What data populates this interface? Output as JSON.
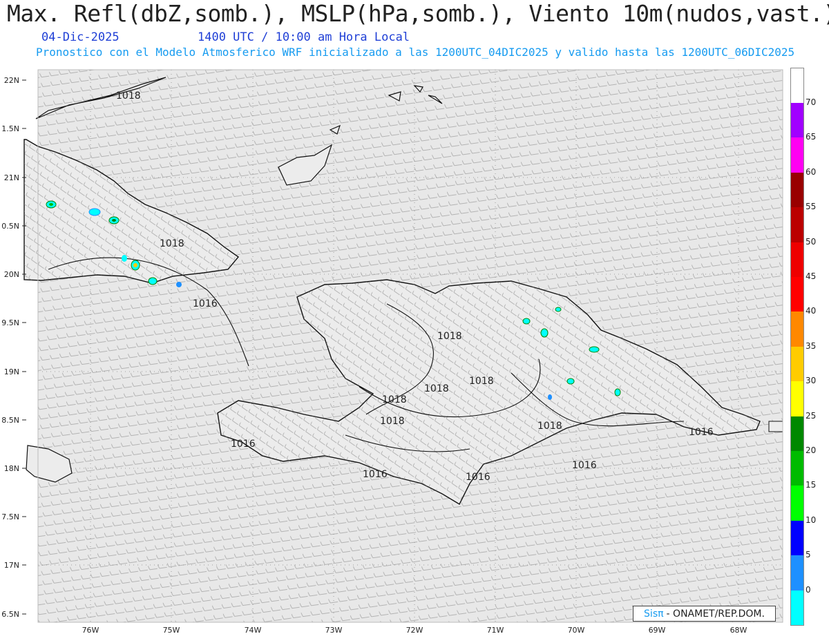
{
  "header": {
    "title": "Max. Refl(dbZ,somb.), MSLP(hPa,somb.), Viento 10m(nudos,vast.)",
    "date": "04-Dic-2025",
    "time": "1400 UTC / 10:00 am Hora Local",
    "model_info": "Pronostico con el Modelo Atmosferico WRF inicializado a las 1200UTC_04DIC2025 y valido hasta las  1200UTC_06DIC2025"
  },
  "axes": {
    "lat_labels": [
      "22N",
      "1.5N",
      "21N",
      "0.5N",
      "20N",
      "9.5N",
      "19N",
      "8.5N",
      "18N",
      "7.5N",
      "17N",
      "6.5N"
    ],
    "lon_labels": [
      "76W",
      "75W",
      "74W",
      "73W",
      "72W",
      "71W",
      "70W",
      "69W",
      "68W"
    ]
  },
  "isobars": [
    {
      "label": "1018"
    },
    {
      "label": "1018"
    },
    {
      "label": "1016"
    },
    {
      "label": "1018"
    },
    {
      "label": "1018"
    },
    {
      "label": "1018"
    },
    {
      "label": "1018"
    },
    {
      "label": "1018"
    },
    {
      "label": "1016"
    },
    {
      "label": "1016"
    },
    {
      "label": "1016"
    },
    {
      "label": "1016"
    },
    {
      "label": "1016"
    },
    {
      "label": "1018"
    }
  ],
  "legend": {
    "unit": "dBZ",
    "levels": [
      "70",
      "65",
      "60",
      "55",
      "50",
      "45",
      "40",
      "35",
      "30",
      "25",
      "20",
      "15",
      "10",
      "5",
      "0"
    ],
    "colors": [
      "#a100ff",
      "#ff00f2",
      "#990000",
      "#bb0000",
      "#ee0000",
      "#ff0000",
      "#ff8800",
      "#ffcc00",
      "#ffff00",
      "#008800",
      "#00bb00",
      "#00ff00",
      "#0000ff",
      "#1e90ff",
      "#00ffff",
      "#e6e6e6"
    ]
  },
  "credit": {
    "logo": "Sisπ",
    "text": "- ONAMET/REP.DOM."
  }
}
